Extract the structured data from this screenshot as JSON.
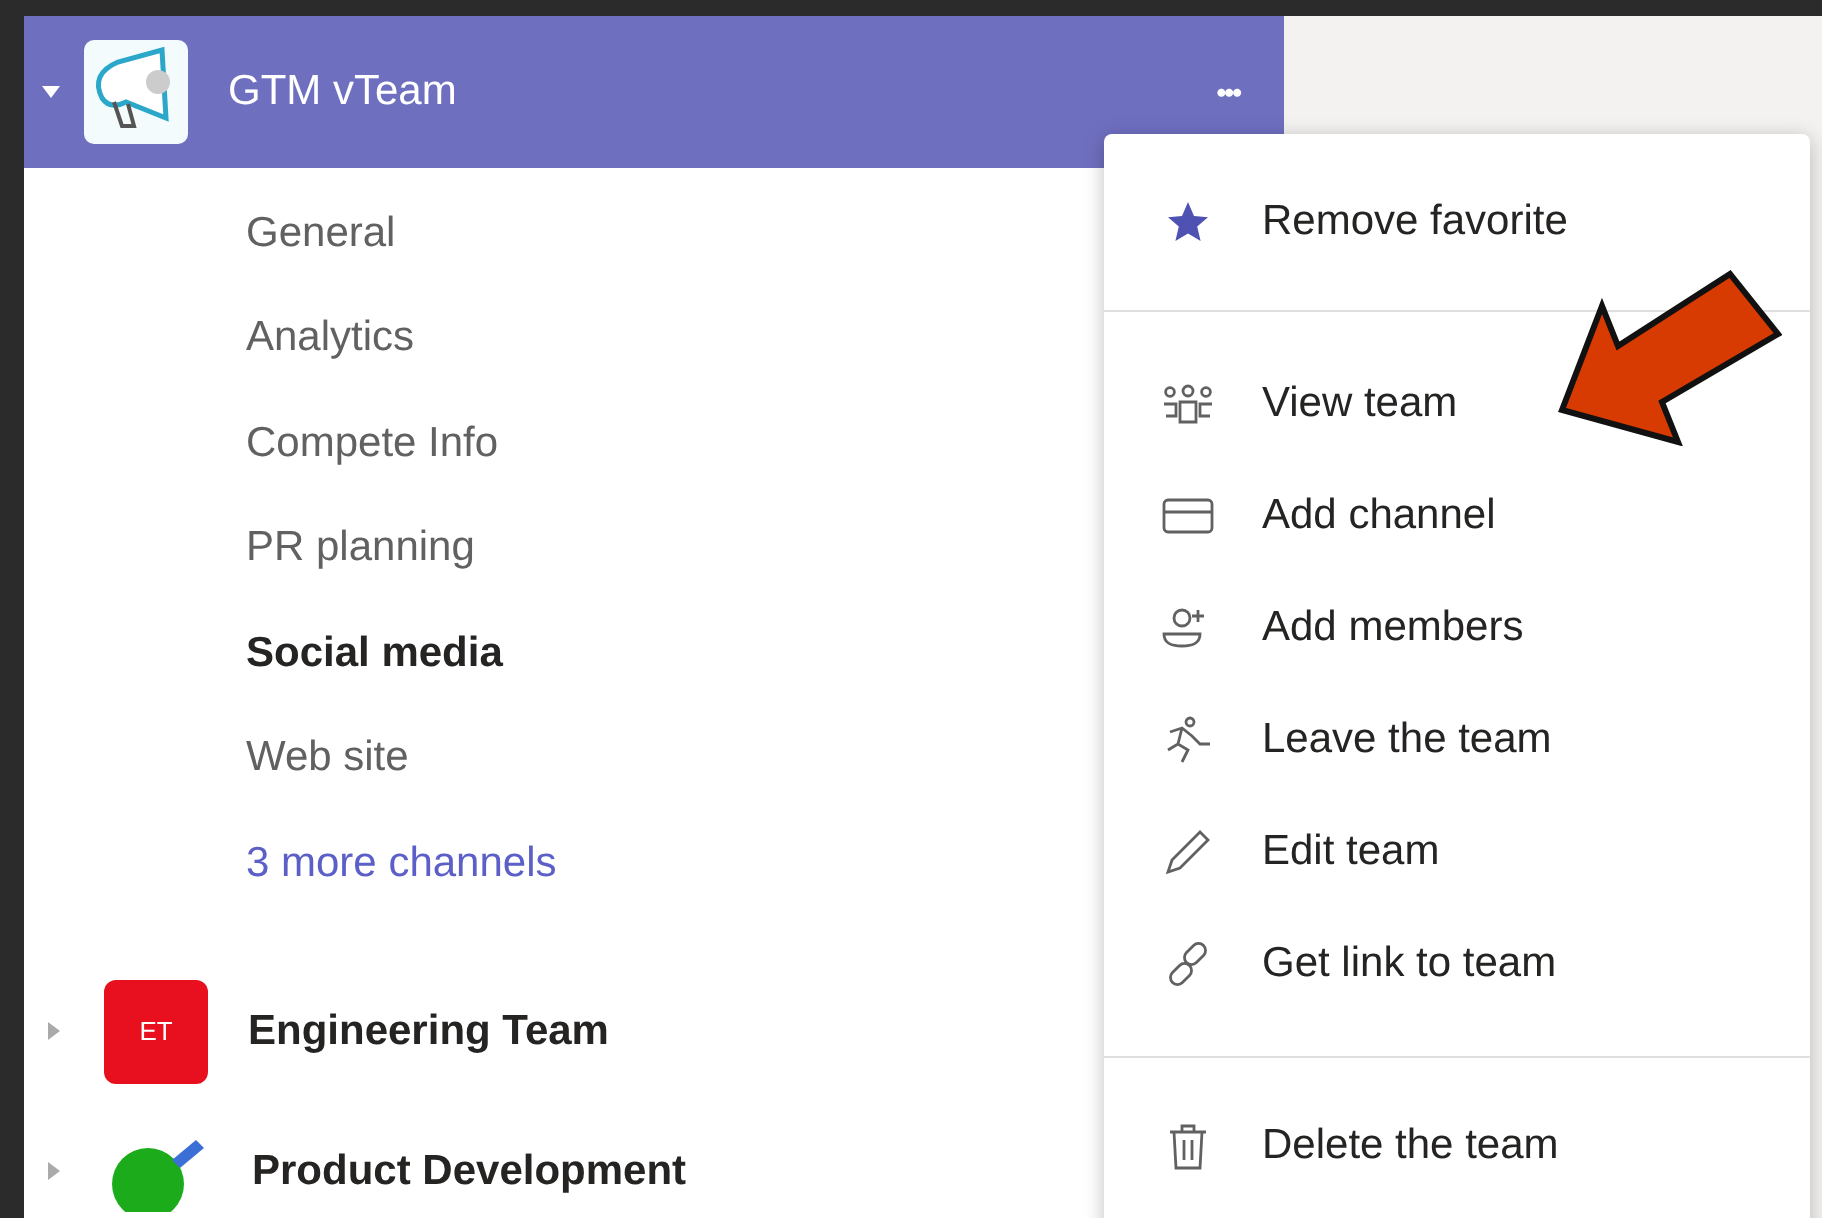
{
  "teams": [
    {
      "name": "GTM vTeam",
      "expanded": true,
      "selected": true,
      "avatar": {
        "kind": "image"
      },
      "more": "•••",
      "channels": [
        {
          "name": "General",
          "kind": "channel",
          "selected": false
        },
        {
          "name": "Analytics",
          "kind": "channel",
          "selected": false
        },
        {
          "name": "Compete Info",
          "kind": "channel",
          "selected": false
        },
        {
          "name": "PR planning",
          "kind": "channel",
          "selected": false
        },
        {
          "name": "Social media",
          "kind": "channel",
          "selected": true
        },
        {
          "name": "Web site",
          "kind": "channel",
          "selected": false
        },
        {
          "name": "3 more channels",
          "kind": "more"
        }
      ]
    },
    {
      "name": "Engineering Team",
      "expanded": false,
      "selected": false,
      "avatar": {
        "kind": "initials",
        "text": "ET",
        "color": "#e8101e"
      }
    },
    {
      "name": "Product Development",
      "expanded": false,
      "selected": false,
      "avatar": {
        "kind": "image"
      }
    }
  ],
  "menu": {
    "groups": [
      [
        {
          "label": "Remove favorite",
          "kind": "star"
        }
      ],
      [
        {
          "label": "View team",
          "kind": "team"
        },
        {
          "label": "Add channel",
          "kind": "channel"
        },
        {
          "label": "Add members",
          "kind": "add-person"
        },
        {
          "label": "Leave the team",
          "kind": "leave"
        },
        {
          "label": "Edit team",
          "kind": "pencil"
        },
        {
          "label": "Get link to team",
          "kind": "link"
        }
      ],
      [
        {
          "label": "Delete the team",
          "kind": "trash"
        }
      ]
    ]
  }
}
